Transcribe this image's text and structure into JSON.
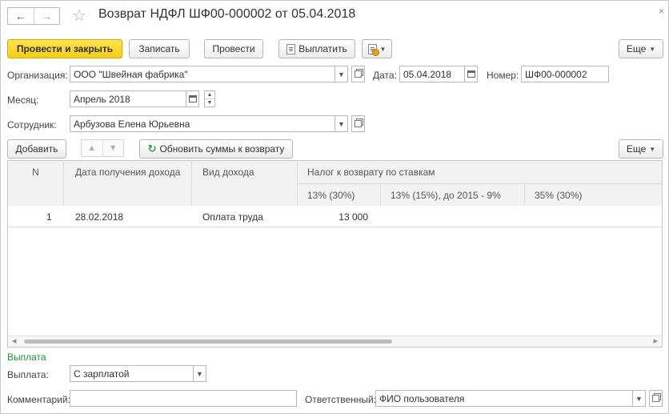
{
  "window": {
    "title": "Возврат НДФЛ ШФ00-000002 от 05.04.2018",
    "nav_back": "←",
    "nav_forward": "→",
    "favorite_glyph": "☆",
    "close_glyph": "×"
  },
  "toolbar": {
    "post_close_label": "Провести и закрыть",
    "save_label": "Записать",
    "post_label": "Провести",
    "pay_label": "Выплатить",
    "more_label": "Еще"
  },
  "form": {
    "org_label": "Организация:",
    "org_value": "ООО \"Швейная фабрика\"",
    "date_label": "Дата:",
    "date_value": "05.04.2018",
    "number_label": "Номер:",
    "number_value": "ШФ00-000002",
    "month_label": "Месяц:",
    "month_value": "Апрель 2018",
    "employee_label": "Сотрудник:",
    "employee_value": "Арбузова Елена Юрьевна"
  },
  "table_toolbar": {
    "add_label": "Добавить",
    "refresh_label": "Обновить суммы к возврату",
    "more_label": "Еще"
  },
  "table": {
    "headers": {
      "n": "N",
      "income_date": "Дата получения дохода",
      "income_type": "Вид дохода",
      "tax_group": "Налог к возврату по ставкам",
      "rate13": "13% (30%)",
      "rate13_15": "13% (15%), до 2015 - 9%",
      "rate35": "35% (30%)"
    },
    "rows": [
      {
        "n": "1",
        "income_date": "28.02.2018",
        "income_type": "Оплата труда",
        "rate13": "13 000",
        "rate13_15": "",
        "rate35": ""
      }
    ]
  },
  "payment": {
    "section_title": "Выплата",
    "payment_label": "Выплата:",
    "payment_value": "С зарплатой",
    "comment_label": "Комментарий:",
    "comment_value": "",
    "responsible_label": "Ответственный:",
    "responsible_value": "ФИО пользователя"
  },
  "icons": {
    "dropdown": "chevron-down-icon",
    "open": "open-form-icon",
    "calendar": "calendar-icon",
    "refresh": "refresh-icon"
  },
  "colors": {
    "primary_button": "#f4cd17",
    "section_title": "#2a8c3a"
  }
}
